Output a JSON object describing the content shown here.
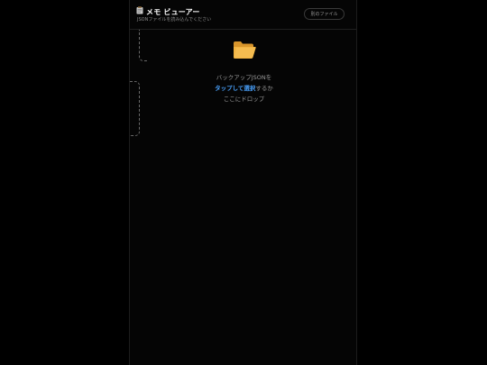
{
  "header": {
    "title": "メモ ビューアー",
    "subtitle": "JSONファイルを読み込んでください",
    "other_file_label": "別のファイル",
    "title_icon": "memo-clipboard-icon"
  },
  "dropzone": {
    "icon": "open-folder-icon",
    "line1": "バックアップJSONを",
    "link_text": "タップして選択",
    "line2_suffix": "するか",
    "line3": "ここにドロップ"
  },
  "colors": {
    "background": "#000000",
    "accent_link": "#4aa3ff",
    "muted_text": "#9a9a9a",
    "folder": "#f2b441"
  }
}
